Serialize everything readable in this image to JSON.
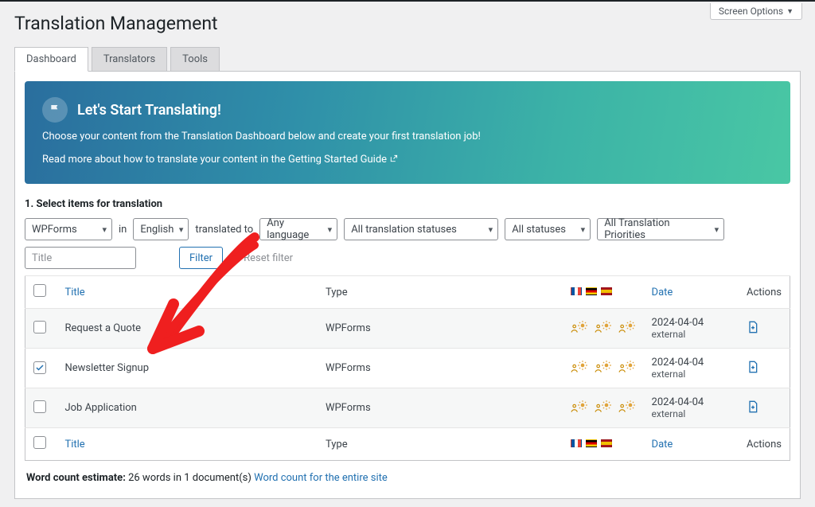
{
  "screenOptions": {
    "label": "Screen Options"
  },
  "page": {
    "title": "Translation Management"
  },
  "tabs": [
    {
      "label": "Dashboard",
      "active": true
    },
    {
      "label": "Translators",
      "active": false
    },
    {
      "label": "Tools",
      "active": false
    }
  ],
  "banner": {
    "heading": "Let's Start Translating!",
    "line1": "Choose your content from the Translation Dashboard below and create your first translation job!",
    "line2_prefix": "Read more about how to translate your content in the ",
    "line2_link": "Getting Started Guide"
  },
  "section1": {
    "title": "1. Select items for translation"
  },
  "filters": {
    "contentType": "WPForms",
    "inLabel": "in",
    "sourceLang": "English",
    "translatedToLabel": "translated to",
    "targetLang": "Any language",
    "translationStatus": "All translation statuses",
    "status": "All statuses",
    "priority": "All Translation Priorities",
    "titlePlaceholder": "Title",
    "filterButton": "Filter",
    "resetFilter": "Reset filter"
  },
  "table": {
    "headers": {
      "title": "Title",
      "type": "Type",
      "date": "Date",
      "actions": "Actions"
    },
    "rows": [
      {
        "checked": false,
        "title": "Request a Quote",
        "type": "WPForms",
        "date": "2024-04-04",
        "dateSub": "external"
      },
      {
        "checked": true,
        "title": "Newsletter Signup",
        "type": "WPForms",
        "date": "2024-04-04",
        "dateSub": "external"
      },
      {
        "checked": false,
        "title": "Job Application",
        "type": "WPForms",
        "date": "2024-04-04",
        "dateSub": "external"
      }
    ]
  },
  "wordCount": {
    "label": "Word count estimate:",
    "value": "26 words in 1 document(s)",
    "link": "Word count for the entire site"
  }
}
